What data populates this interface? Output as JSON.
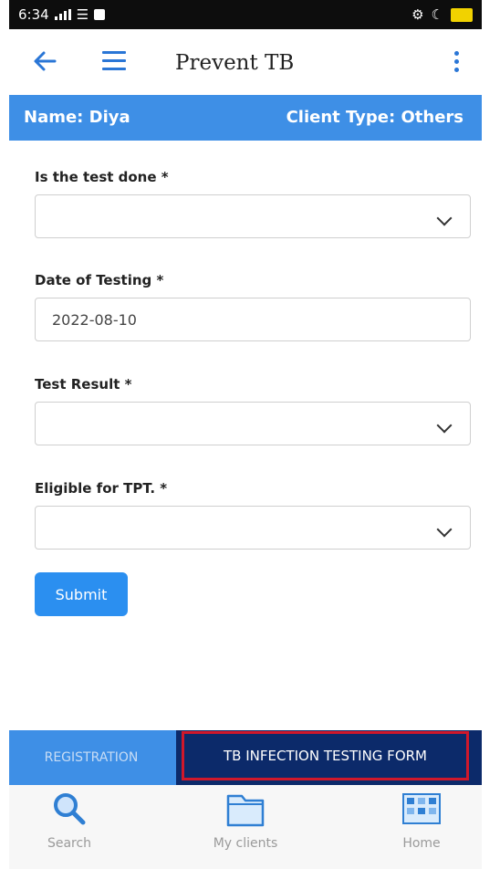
{
  "status_bar": {
    "time": "6:34"
  },
  "app_bar": {
    "title": "Prevent TB"
  },
  "client": {
    "name": "Name: Diya",
    "type": "Client Type: Others"
  },
  "form": {
    "fields": [
      {
        "label": "Is the test done *",
        "value": ""
      },
      {
        "label": "Date of Testing *",
        "value": "2022-08-10"
      },
      {
        "label": "Test Result *",
        "value": ""
      },
      {
        "label": "Eligible for TPT. *",
        "value": ""
      }
    ],
    "submit_label": "Submit"
  },
  "tabs": [
    {
      "label": "REGISTRATION",
      "active": false
    },
    {
      "label": "TB INFECTION TESTING FORM",
      "active": true
    }
  ],
  "bottom_nav": [
    {
      "label": "Search",
      "icon": "search-icon"
    },
    {
      "label": "My clients",
      "icon": "folder-icon"
    },
    {
      "label": "Home",
      "icon": "home-grid-icon"
    }
  ],
  "colors": {
    "primary": "#3e8fe6",
    "active_tab": "#0c2a6a",
    "highlight_border": "#d0182b"
  }
}
